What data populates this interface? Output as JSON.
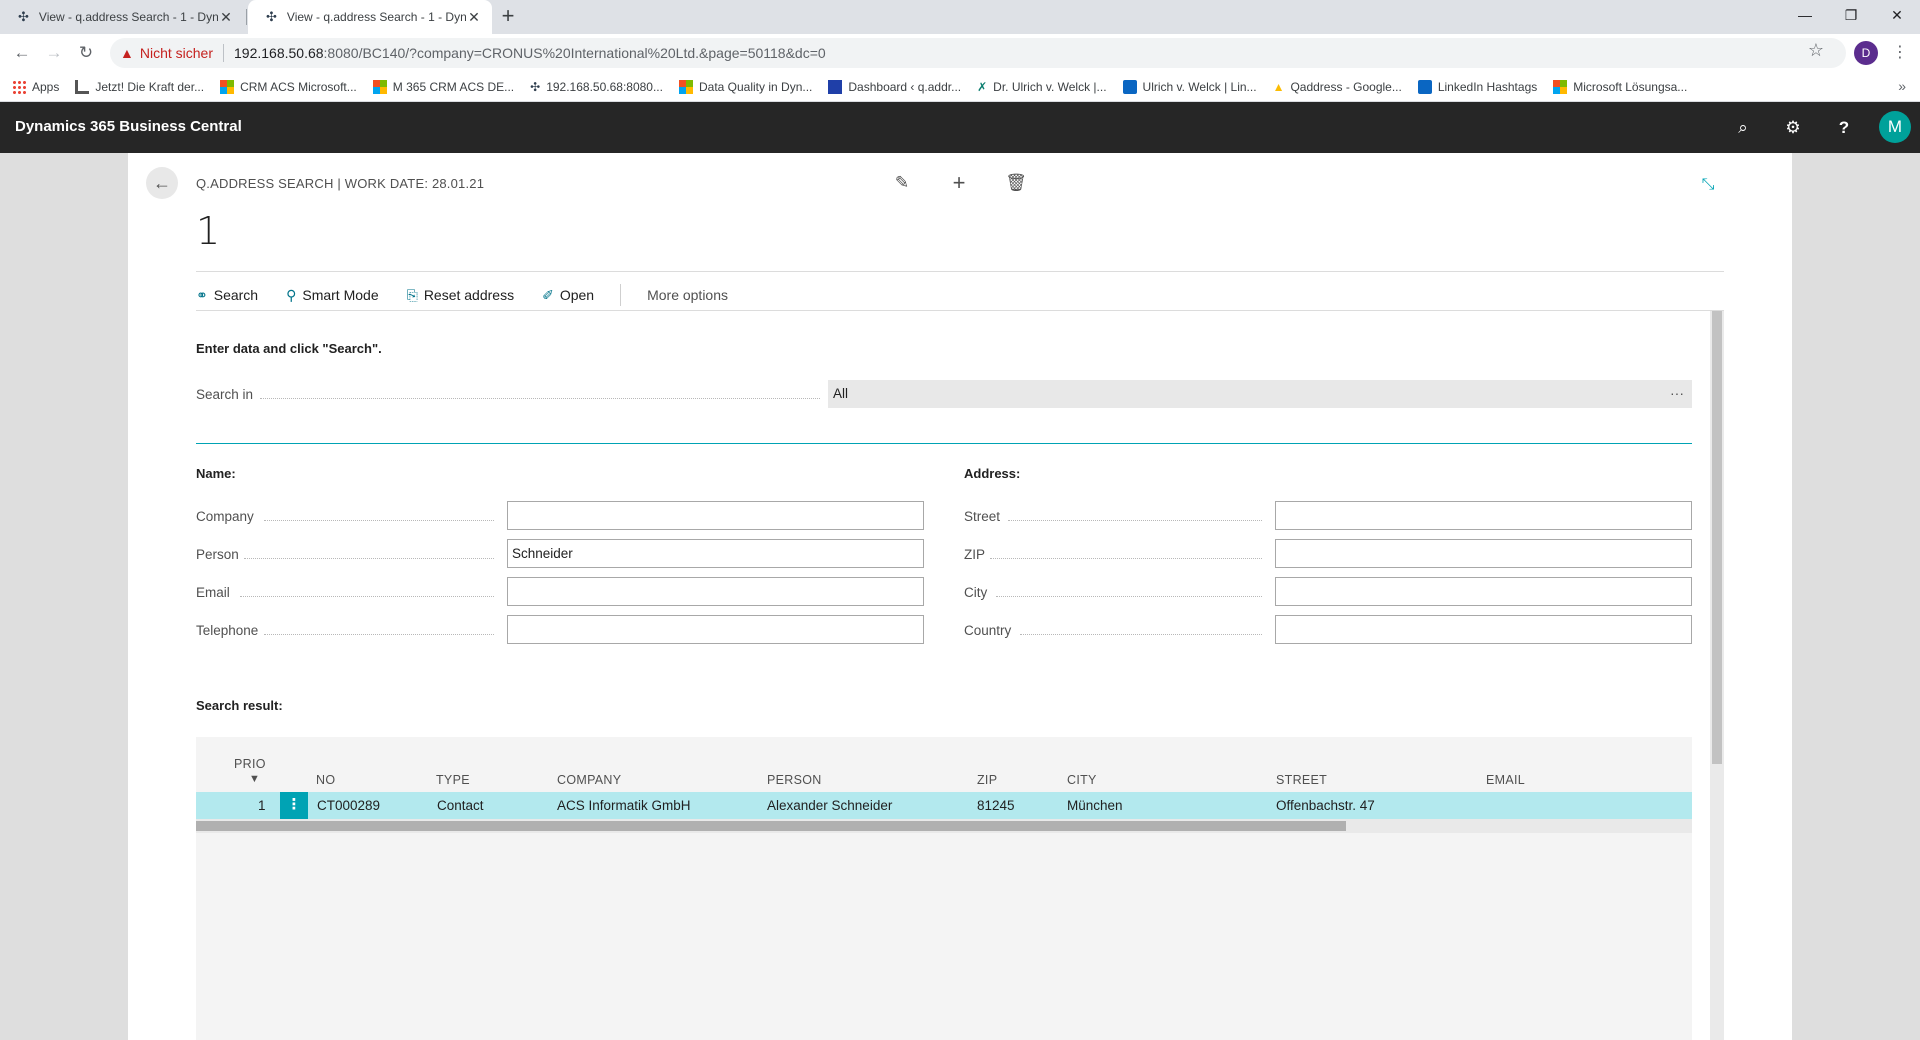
{
  "browser": {
    "tabs": [
      {
        "title": "View - q.address Search - 1 - Dyn",
        "active": false
      },
      {
        "title": "View - q.address Search - 1 - Dyn",
        "active": true
      }
    ],
    "security_label": "Nicht sicher",
    "url_host": "192.168.50.68",
    "url_path": ":8080/BC140/?company=CRONUS%20International%20Ltd.&page=50118&dc=0",
    "profile_initial": "D",
    "bookmarks": [
      {
        "label": "Apps",
        "icon": "apps-grid-icon",
        "color": "#1a73e8"
      },
      {
        "label": "Jetzt! Die Kraft der...",
        "icon": "page-icon",
        "color": "#555555"
      },
      {
        "label": "CRM ACS Microsoft...",
        "icon": "microsoft-icon",
        "color": "#f25022"
      },
      {
        "label": "M 365 CRM ACS DE...",
        "icon": "microsoft-icon",
        "color": "#f25022"
      },
      {
        "label": "192.168.50.68:8080...",
        "icon": "dynamics-icon",
        "color": "#2f3e4e"
      },
      {
        "label": "Data Quality in Dyn...",
        "icon": "microsoft-icon",
        "color": "#f25022"
      },
      {
        "label": "Dashboard ‹ q.addr...",
        "icon": "qaddress-icon",
        "color": "#1f3fa8"
      },
      {
        "label": "Dr. Ulrich v. Welck |...",
        "icon": "xing-icon",
        "color": "#0a7d6e"
      },
      {
        "label": "Ulrich v. Welck | Lin...",
        "icon": "linkedin-icon",
        "color": "#0a66c2"
      },
      {
        "label": "Qaddress - Google...",
        "icon": "google-ads-icon",
        "color": "#fbbc04"
      },
      {
        "label": "LinkedIn Hashtags",
        "icon": "linkedin-icon",
        "color": "#0a66c2"
      },
      {
        "label": "Microsoft Lösungsa...",
        "icon": "microsoft-icon",
        "color": "#f25022"
      }
    ]
  },
  "app": {
    "title": "Dynamics 365 Business Central",
    "user_initial": "M",
    "accent": "#00a3b4"
  },
  "page": {
    "caption": "Q.ADDRESS SEARCH | WORK DATE: 28.01.21",
    "record_title": "1",
    "actions": {
      "search": "Search",
      "smart_mode": "Smart Mode",
      "reset_address": "Reset address",
      "open": "Open",
      "more_options": "More options"
    },
    "instruction": "Enter data and click \"Search\".",
    "search_in": {
      "label": "Search in",
      "value": "All",
      "ellipsis": "···"
    },
    "name_group": {
      "title": "Name:",
      "fields": [
        {
          "label": "Company",
          "value": ""
        },
        {
          "label": "Person",
          "value": "Schneider"
        },
        {
          "label": "Email",
          "value": ""
        },
        {
          "label": "Telephone",
          "value": ""
        }
      ]
    },
    "address_group": {
      "title": "Address:",
      "fields": [
        {
          "label": "Street",
          "value": ""
        },
        {
          "label": "ZIP",
          "value": ""
        },
        {
          "label": "City",
          "value": ""
        },
        {
          "label": "Country",
          "value": ""
        }
      ]
    },
    "results": {
      "title": "Search result:",
      "columns": [
        "PRIO",
        "NO",
        "TYPE",
        "COMPANY",
        "PERSON",
        "ZIP",
        "CITY",
        "STREET",
        "EMAIL"
      ],
      "rows": [
        {
          "prio": "1",
          "no": "CT000289",
          "type": "Contact",
          "company": "ACS Informatik GmbH",
          "person": "Alexander Schneider",
          "zip": "81245",
          "city": "München",
          "street": "Offenbachstr. 47",
          "email": ""
        }
      ]
    }
  }
}
